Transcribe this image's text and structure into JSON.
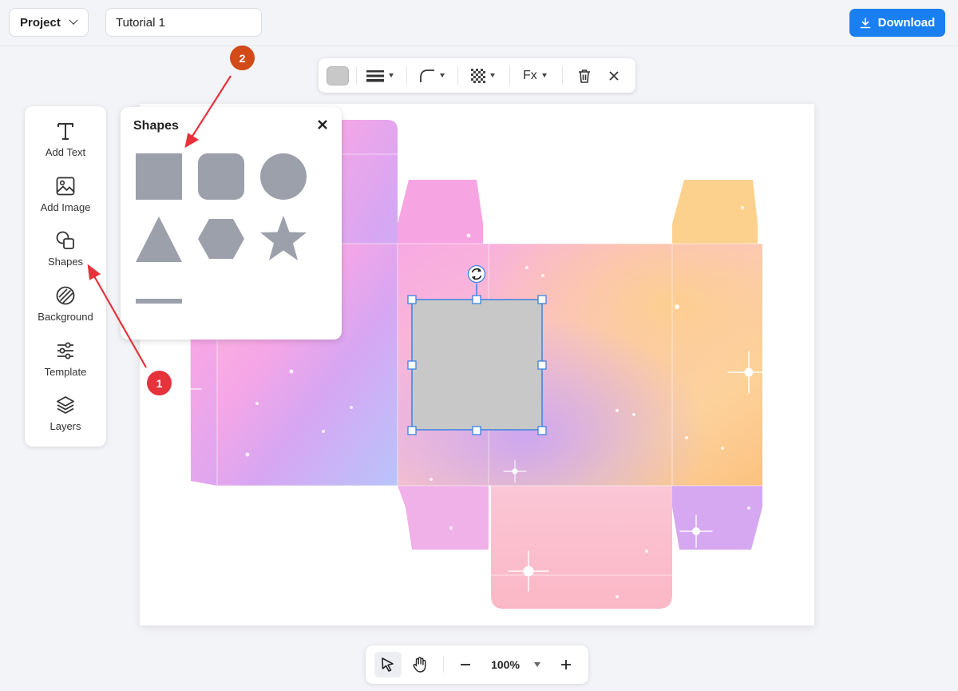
{
  "header": {
    "project_label": "Project",
    "project_name": "Tutorial 1",
    "download_label": "Download"
  },
  "left_toolbar": {
    "items": [
      {
        "label": "Add Text",
        "icon": "text-icon"
      },
      {
        "label": "Add Image",
        "icon": "image-icon"
      },
      {
        "label": "Shapes",
        "icon": "shapes-icon"
      },
      {
        "label": "Background",
        "icon": "background-icon"
      },
      {
        "label": "Template",
        "icon": "sliders-icon"
      },
      {
        "label": "Layers",
        "icon": "layers-icon"
      }
    ]
  },
  "shapes_panel": {
    "title": "Shapes",
    "shapes": [
      "square",
      "rounded-square",
      "circle",
      "triangle",
      "hexagon",
      "star",
      "line"
    ]
  },
  "format_toolbar": {
    "fill_color": "#c8c8c8",
    "items": [
      "fill-color-swatch",
      "stroke-width-icon",
      "corner-radius-icon",
      "opacity-icon",
      "effects"
    ],
    "effects_label": "Fx"
  },
  "zoom": {
    "level": "100%"
  },
  "annotations": [
    {
      "number": "1",
      "color": "#e5323b"
    },
    {
      "number": "2",
      "color": "#d14a18"
    }
  ],
  "colors": {
    "accent": "#1a7ff0",
    "shape_gray": "#9ca0ab",
    "selection": "#3b82e0",
    "annotation_arrow": "#e5323b"
  }
}
